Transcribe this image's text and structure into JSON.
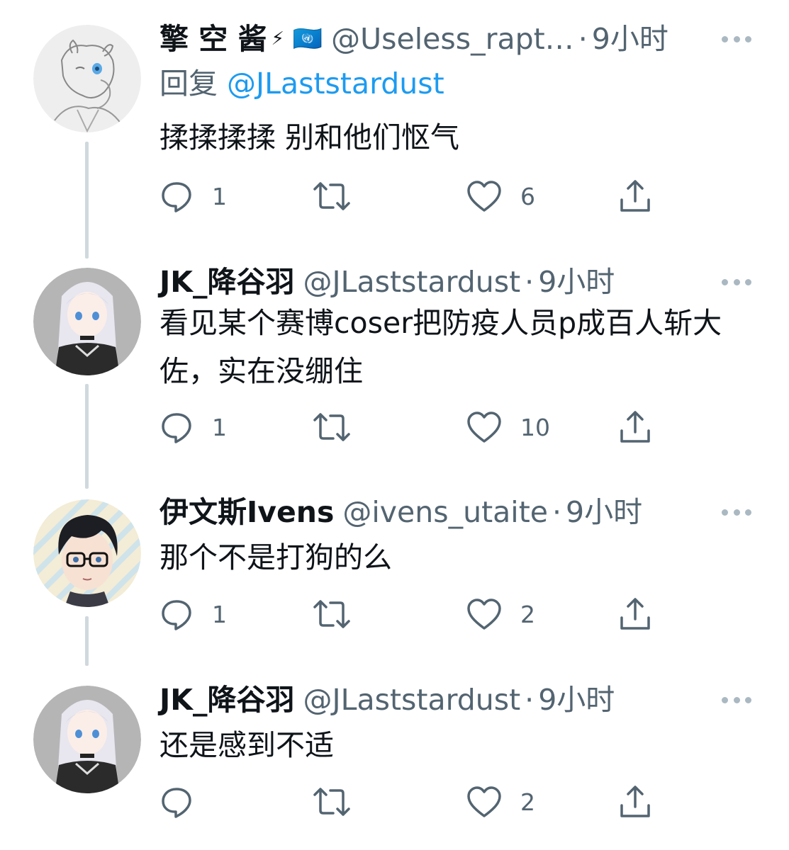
{
  "tweets": [
    {
      "name": "擎 空 酱",
      "badges": [
        "⚡",
        "🇺🇳"
      ],
      "handle": "@Useless_rapt…",
      "time": "9小时",
      "reply_prefix": "回复",
      "reply_handle": "@JLaststardust",
      "text": "揉揉揉揉 别和他们怄气",
      "replies": "1",
      "retweets": "",
      "likes": "6"
    },
    {
      "name": "JK_降谷羽",
      "handle": "@JLaststardust",
      "time": "9小时",
      "text": "看见某个赛博coser把防疫人员p成百人斩大佐，实在没绷住",
      "replies": "1",
      "retweets": "",
      "likes": "10"
    },
    {
      "name": "伊文斯Ivens",
      "handle": "@ivens_utaite",
      "time": "9小时",
      "text": "那个不是打狗的么",
      "replies": "1",
      "retweets": "",
      "likes": "2"
    },
    {
      "name": "JK_降谷羽",
      "handle": "@JLaststardust",
      "time": "9小时",
      "text": "还是感到不适",
      "replies": "",
      "retweets": "",
      "likes": "2"
    }
  ],
  "separator": "·",
  "icons": [
    "reply-icon",
    "retweet-icon",
    "like-icon",
    "share-icon",
    "more-icon"
  ],
  "colors": {
    "link": "#1d9bf0",
    "secondary_text": "#536471",
    "thread_line": "#cfd9de"
  }
}
